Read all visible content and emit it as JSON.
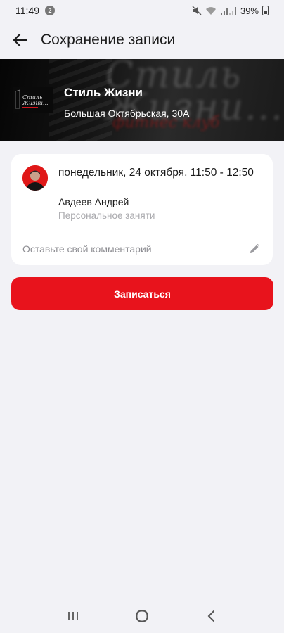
{
  "status_bar": {
    "time": "11:49",
    "notification_count": "2",
    "battery": "39%",
    "icons": [
      "mute-icon",
      "wifi-icon",
      "signal-icon",
      "battery-icon"
    ]
  },
  "app_bar": {
    "back_icon": "arrow-left-icon",
    "title": "Сохранение записи"
  },
  "club": {
    "name": "Стиль Жизни",
    "address": "Большая Октябрьская, 30А",
    "banner_text": "Стиль Жизни...",
    "banner_subtext": "фитнес клуб"
  },
  "booking": {
    "datetime": "понедельник, 24 октября, 11:50 - 12:50",
    "trainer": "Авдеев Андрей",
    "session_type": "Персональное заняти",
    "comment_placeholder": "Оставьте свой комментарий",
    "comment_value": ""
  },
  "actions": {
    "submit_label": "Записаться"
  },
  "colors": {
    "accent": "#e8131c",
    "background": "#f2f2f6",
    "card": "#ffffff",
    "muted_text": "#a9a9ad"
  },
  "nav": {
    "items": [
      "recent-apps-icon",
      "home-icon",
      "back-icon"
    ]
  }
}
